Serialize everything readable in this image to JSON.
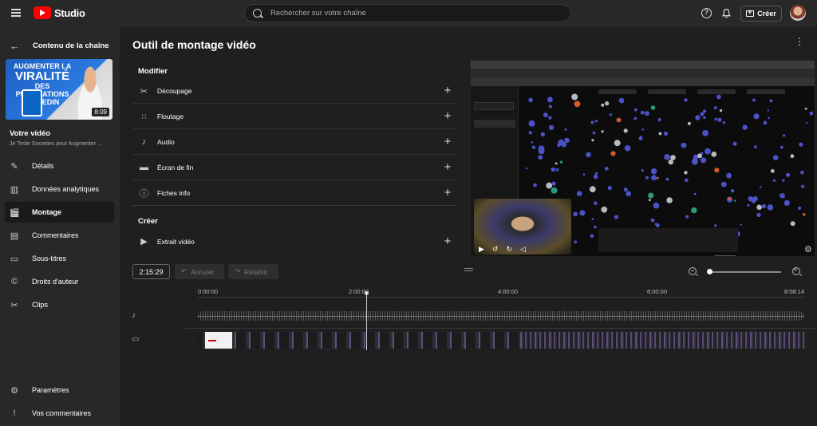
{
  "app": {
    "logo_text": "Studio",
    "brand_color": "#ff0000"
  },
  "header": {
    "search_placeholder": "Rechercher sur votre chaîne",
    "create_label": "Créer",
    "help_glyph": "?"
  },
  "sidebar": {
    "back_label": "Contenu de la chaîne",
    "thumbnail": {
      "line1": "AUGMENTER LA",
      "line2": "VIRALITÉ",
      "line3": "DES PUBLICATIONS",
      "line4": "LINKEDIN",
      "duration": "8:09"
    },
    "video_heading": "Votre vidéo",
    "video_subtitle": "Je Teste Societies pour Augmenter ...",
    "items": [
      {
        "label": "Détails",
        "icon": "pencil-icon"
      },
      {
        "label": "Données analytiques",
        "icon": "analytics-icon"
      },
      {
        "label": "Montage",
        "icon": "clapper-icon",
        "active": true
      },
      {
        "label": "Commentaires",
        "icon": "comments-icon"
      },
      {
        "label": "Sous-titres",
        "icon": "subtitles-icon"
      },
      {
        "label": "Droits d'auteur",
        "icon": "copyright-icon"
      },
      {
        "label": "Clips",
        "icon": "scissors-icon"
      }
    ],
    "bottom_items": [
      {
        "label": "Paramètres",
        "icon": "gear-icon"
      },
      {
        "label": "Vos commentaires",
        "icon": "feedback-icon"
      }
    ]
  },
  "main": {
    "title": "Outil de montage vidéo",
    "modify_section": "Modifier",
    "tools": [
      {
        "label": "Découpage",
        "icon": "scissors-icon"
      },
      {
        "label": "Floutage",
        "icon": "blur-icon"
      },
      {
        "label": "Audio",
        "icon": "music-note-icon"
      },
      {
        "label": "Écran de fin",
        "icon": "end-screen-icon"
      },
      {
        "label": "Fiches info",
        "icon": "info-icon"
      }
    ],
    "create_section": "Créer",
    "create_tools": [
      {
        "label": "Extrait vidéo",
        "icon": "video-clip-icon"
      }
    ]
  },
  "timeline": {
    "current_time": "2:15:29",
    "undo_label": "Annuler",
    "redo_label": "Rétablir",
    "ruler_labels": [
      "0:00:00",
      "2:00:00",
      "4:00:00",
      "6:00:00",
      "8:08:14"
    ],
    "zoom_fraction": 0.0
  }
}
